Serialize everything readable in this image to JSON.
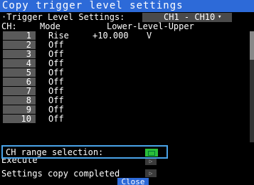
{
  "title": "Copy trigger level settings",
  "settings": {
    "label": "·Trigger Level Settings:",
    "range_value": "CH1 - CH10",
    "dropdown_arrow": "▾"
  },
  "table": {
    "headers": {
      "ch": "CH:",
      "mode": "Mode",
      "lower_upper": "Lower-Level-Upper"
    },
    "rows": [
      {
        "ch": "1",
        "mode": "Rise",
        "lower": "+10.000",
        "unit": "V"
      },
      {
        "ch": "2",
        "mode": "Off",
        "lower": "",
        "unit": ""
      },
      {
        "ch": "3",
        "mode": "Off",
        "lower": "",
        "unit": ""
      },
      {
        "ch": "4",
        "mode": "Off",
        "lower": "",
        "unit": ""
      },
      {
        "ch": "5",
        "mode": "Off",
        "lower": "",
        "unit": ""
      },
      {
        "ch": "6",
        "mode": "Off",
        "lower": "",
        "unit": ""
      },
      {
        "ch": "7",
        "mode": "Off",
        "lower": "",
        "unit": ""
      },
      {
        "ch": "8",
        "mode": "Off",
        "lower": "",
        "unit": ""
      },
      {
        "ch": "9",
        "mode": "Off",
        "lower": "",
        "unit": ""
      },
      {
        "ch": "10",
        "mode": "Off",
        "lower": "",
        "unit": ""
      }
    ]
  },
  "bottom": {
    "ch_range_label": "CH range selection:",
    "execute_label": "Execute",
    "completed_label": "Settings copy completed",
    "play_glyph": "▷",
    "close_label": "Close"
  },
  "colors": {
    "title_bg": "#2d6ad8",
    "focus_border": "#4aa3e8",
    "toggle_on": "#2bbf3a"
  }
}
